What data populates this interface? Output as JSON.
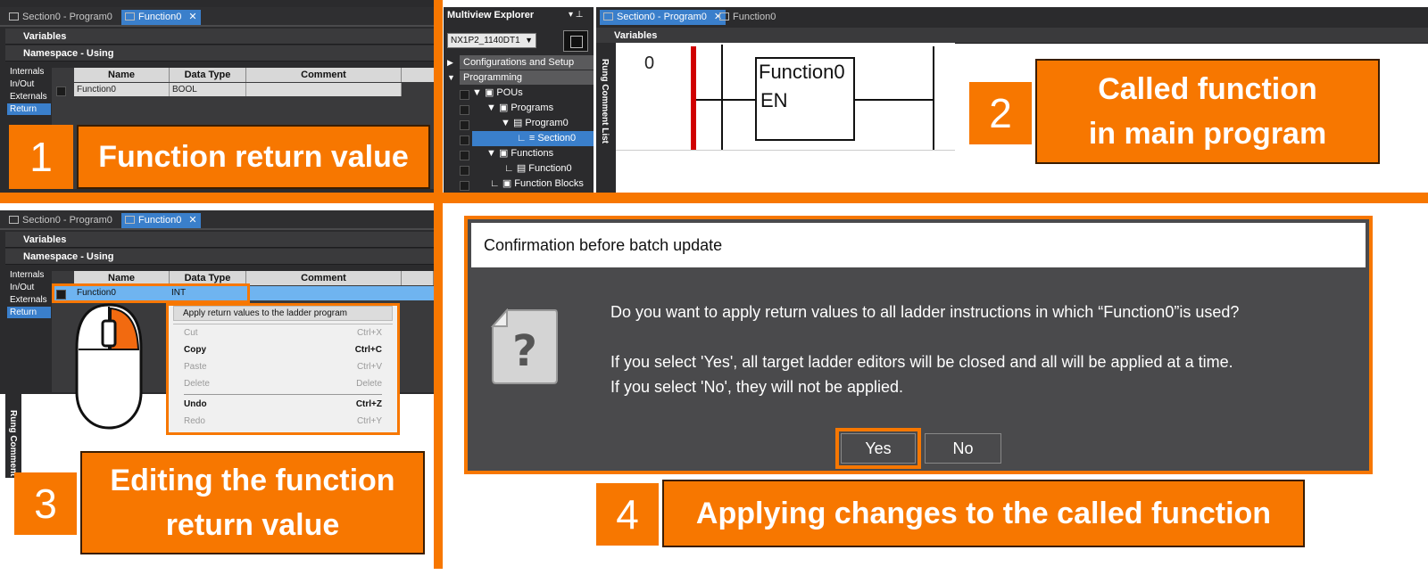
{
  "panel1": {
    "tabs": [
      {
        "label": "Section0 - Program0",
        "active": false
      },
      {
        "label": "Function0",
        "active": true
      }
    ],
    "variables_header": "Variables",
    "namespace_header": "Namespace - Using",
    "side_tabs": [
      "Internals",
      "In/Out",
      "Externals",
      "Return"
    ],
    "selected_side_tab": "Return",
    "columns": [
      "Name",
      "Data Type",
      "Comment"
    ],
    "row": {
      "name": "Function0",
      "data_type": "BOOL",
      "comment": ""
    },
    "callout_number": "1",
    "callout_label": "Function return value"
  },
  "panel2": {
    "explorer_title": "Multiview Explorer",
    "device": "NX1P2_1140DT1",
    "tree": [
      {
        "label": "Configurations and Setup",
        "level": 0,
        "section": true
      },
      {
        "label": "Programming",
        "level": 0,
        "section": true
      },
      {
        "label": "POUs",
        "level": 1
      },
      {
        "label": "Programs",
        "level": 2
      },
      {
        "label": "Program0",
        "level": 3
      },
      {
        "label": "Section0",
        "level": 4,
        "selected": true
      },
      {
        "label": "Functions",
        "level": 2
      },
      {
        "label": "Function0",
        "level": 3
      },
      {
        "label": "Function Blocks",
        "level": 2
      }
    ],
    "tabs": [
      {
        "label": "Section0 - Program0",
        "active": true
      },
      {
        "label": "Function0",
        "active": false
      }
    ],
    "variables_header": "Variables",
    "rung_comment_list": "Rung Comment List",
    "rung_number": "0",
    "block_name": "Function0",
    "block_input": "EN",
    "callout_number": "2",
    "callout_label_line1": "Called function",
    "callout_label_line2": "in main program"
  },
  "panel3": {
    "tabs": [
      {
        "label": "Section0 - Program0",
        "active": false
      },
      {
        "label": "Function0",
        "active": true
      }
    ],
    "variables_header": "Variables",
    "namespace_header": "Namespace - Using",
    "side_tabs": [
      "Internals",
      "In/Out",
      "Externals",
      "Return"
    ],
    "selected_side_tab": "Return",
    "columns": [
      "Name",
      "Data Type",
      "Comment"
    ],
    "row": {
      "name": "Function0",
      "data_type": "INT",
      "comment": ""
    },
    "context_menu": {
      "top_item": "Apply return values to the ladder program",
      "items": [
        {
          "label": "Cut",
          "shortcut": "Ctrl+X",
          "enabled": false
        },
        {
          "label": "Copy",
          "shortcut": "Ctrl+C",
          "enabled": true
        },
        {
          "label": "Paste",
          "shortcut": "Ctrl+V",
          "enabled": false
        },
        {
          "label": "Delete",
          "shortcut": "Delete",
          "enabled": false
        },
        {
          "label": "Undo",
          "shortcut": "Ctrl+Z",
          "enabled": true
        },
        {
          "label": "Redo",
          "shortcut": "Ctrl+Y",
          "enabled": false
        }
      ]
    },
    "rung_comment": "Rung Comment",
    "callout_number": "3",
    "callout_label_line1": "Editing the function",
    "callout_label_line2": "return value"
  },
  "panel4": {
    "dialog_title": "Confirmation before batch update",
    "message_line1": "Do you want to apply return values to all ladder instructions in which “Function0”is used?",
    "message_line2": "If you select 'Yes', all target ladder editors will be closed and all will be applied at a time.",
    "message_line3": "If you select 'No', they will not be applied.",
    "yes_label": "Yes",
    "no_label": "No",
    "callout_number": "4",
    "callout_label": "Applying changes to the called function"
  },
  "colors": {
    "accent_orange": "#f77700",
    "selection_blue": "#3a7fcb",
    "panel_dark": "#2b2b2d",
    "dialog_dark": "#4a4a4c",
    "rail_red": "#d00000"
  }
}
